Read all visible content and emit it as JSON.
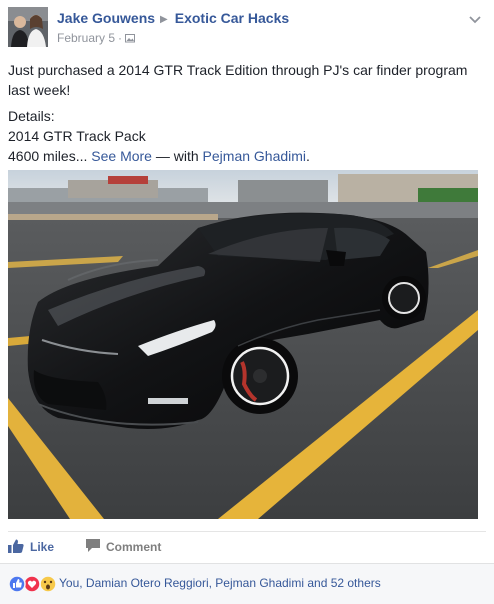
{
  "post": {
    "author": "Jake Gouwens",
    "group": "Exotic Car Hacks",
    "date": "February 5",
    "audience_icon": "photo-album-icon",
    "text_line1": "Just purchased a 2014 GTR Track Edition through PJ's car finder program last week!",
    "details_label": "Details:",
    "details_line1": "2014 GTR Track Pack",
    "details_line2": "4600 miles...",
    "see_more": "See More",
    "with_prefix": " — with ",
    "tagged_person": "Pejman Ghadimi",
    "tagged_suffix": "."
  },
  "actions": {
    "like_label": "Like",
    "comment_label": "Comment"
  },
  "reactions": {
    "icons": [
      "like-icon",
      "love-icon",
      "wow-icon"
    ],
    "summary": "You, Damian Otero Reggiori, Pejman Ghadimi and 52 others"
  },
  "colors": {
    "link": "#365899",
    "secondary": "#90949c",
    "like_blue": "#4b67a1",
    "bar_bg": "#f6f7f9"
  }
}
